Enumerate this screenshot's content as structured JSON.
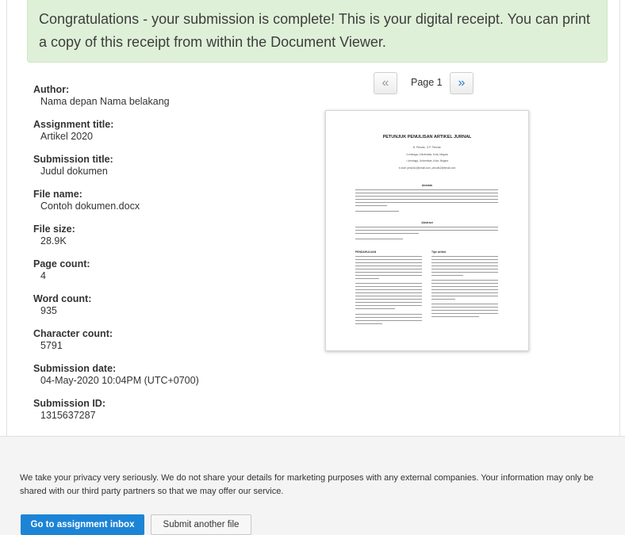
{
  "banner": {
    "message": "Congratulations - your submission is complete! This is your digital receipt. You can print a copy of this receipt from within the Document Viewer."
  },
  "details": [
    {
      "label": "Author:",
      "value": "Nama depan Nama belakang"
    },
    {
      "label": "Assignment title:",
      "value": "Artikel 2020"
    },
    {
      "label": "Submission title:",
      "value": "Judul dokumen"
    },
    {
      "label": "File name:",
      "value": "Contoh dokumen.docx"
    },
    {
      "label": "File size:",
      "value": "28.9K"
    },
    {
      "label": "Page count:",
      "value": "4"
    },
    {
      "label": "Word count:",
      "value": "935"
    },
    {
      "label": "Character count:",
      "value": "5791"
    },
    {
      "label": "Submission date:",
      "value": "04-May-2020 10:04PM (UTC+0700)"
    },
    {
      "label": "Submission ID:",
      "value": "1315637287"
    }
  ],
  "viewer": {
    "prev_glyph": "«",
    "next_glyph": "»",
    "page_label": "Page 1",
    "preview": {
      "title": "PETUNJUK PENULISAN ARTIKEL JURNAL",
      "authors": "B. Penulis¹, S.P. Penulis²",
      "affil1": "¹Lembaga, Universitas, Kota, Negara",
      "affil2": "² Lembaga, Universitas, Kota, Negara",
      "email": "e-mail: penulis1@email.com, penulis2@email.com",
      "abstrak_head": "Abstrak",
      "abstract_head": "Abstract",
      "intro_head": "PENDAHULUAN",
      "type_head": "Tipe Artikel"
    }
  },
  "footer": {
    "privacy": "We take your privacy very seriously. We do not share your details for marketing purposes with any external companies. Your information may only be shared with our third party partners so that we may offer our service.",
    "primary_button": "Go to assignment inbox",
    "secondary_button": "Submit another file"
  },
  "colors": {
    "banner_bg": "#dff0d8",
    "primary": "#1c84d6",
    "footer_bg": "#f4f4f4"
  }
}
